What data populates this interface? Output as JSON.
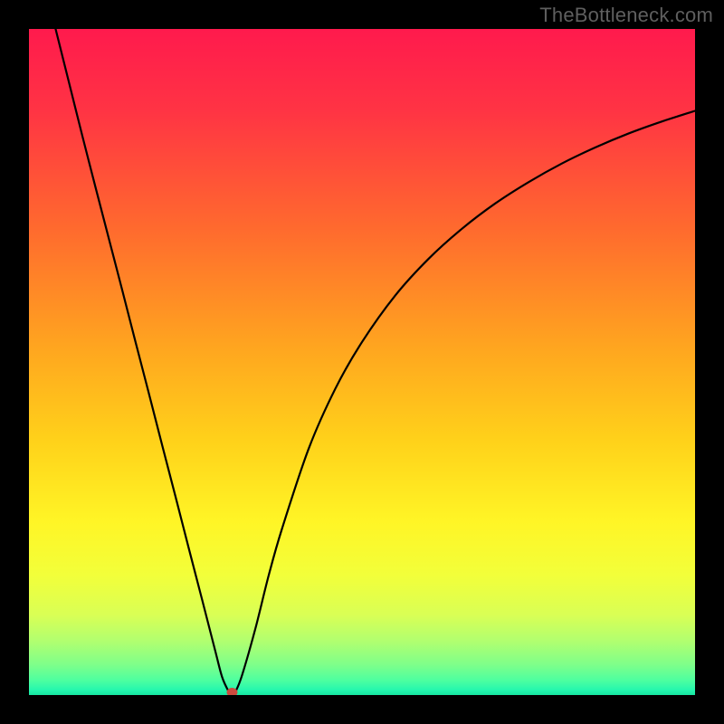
{
  "watermark": "TheBottleneck.com",
  "chart_data": {
    "type": "line",
    "title": "",
    "xlabel": "",
    "ylabel": "",
    "xlim": [
      0,
      100
    ],
    "ylim": [
      0,
      100
    ],
    "x": [
      4,
      6,
      8,
      10,
      12,
      14,
      16,
      18,
      20,
      22,
      24,
      26,
      28,
      29,
      30,
      30.5,
      31,
      32,
      34,
      36,
      38,
      42,
      46,
      50,
      55,
      60,
      65,
      70,
      75,
      80,
      85,
      90,
      95,
      100
    ],
    "y": [
      100,
      92,
      84,
      76.2,
      68.5,
      60.8,
      53,
      45.3,
      37.5,
      29.8,
      22,
      14.3,
      6.5,
      2.7,
      0.5,
      0,
      0.5,
      3,
      10,
      18,
      25,
      37,
      46,
      53,
      60,
      65.5,
      70,
      73.8,
      77,
      79.8,
      82.2,
      84.3,
      86.1,
      87.7
    ],
    "marker": {
      "x": 30.5,
      "y": 0,
      "color": "#cc4b3f"
    },
    "background_gradient": {
      "stops": [
        {
          "offset": 0.0,
          "color": "#ff1a4d"
        },
        {
          "offset": 0.12,
          "color": "#ff3344"
        },
        {
          "offset": 0.3,
          "color": "#ff6a2e"
        },
        {
          "offset": 0.48,
          "color": "#ffa61f"
        },
        {
          "offset": 0.62,
          "color": "#ffd21a"
        },
        {
          "offset": 0.74,
          "color": "#fff526"
        },
        {
          "offset": 0.82,
          "color": "#f2ff3a"
        },
        {
          "offset": 0.88,
          "color": "#d9ff55"
        },
        {
          "offset": 0.92,
          "color": "#b0ff70"
        },
        {
          "offset": 0.955,
          "color": "#7dff8a"
        },
        {
          "offset": 0.978,
          "color": "#4dffa0"
        },
        {
          "offset": 0.992,
          "color": "#26f7ae"
        },
        {
          "offset": 1.0,
          "color": "#16e6a2"
        }
      ]
    }
  }
}
